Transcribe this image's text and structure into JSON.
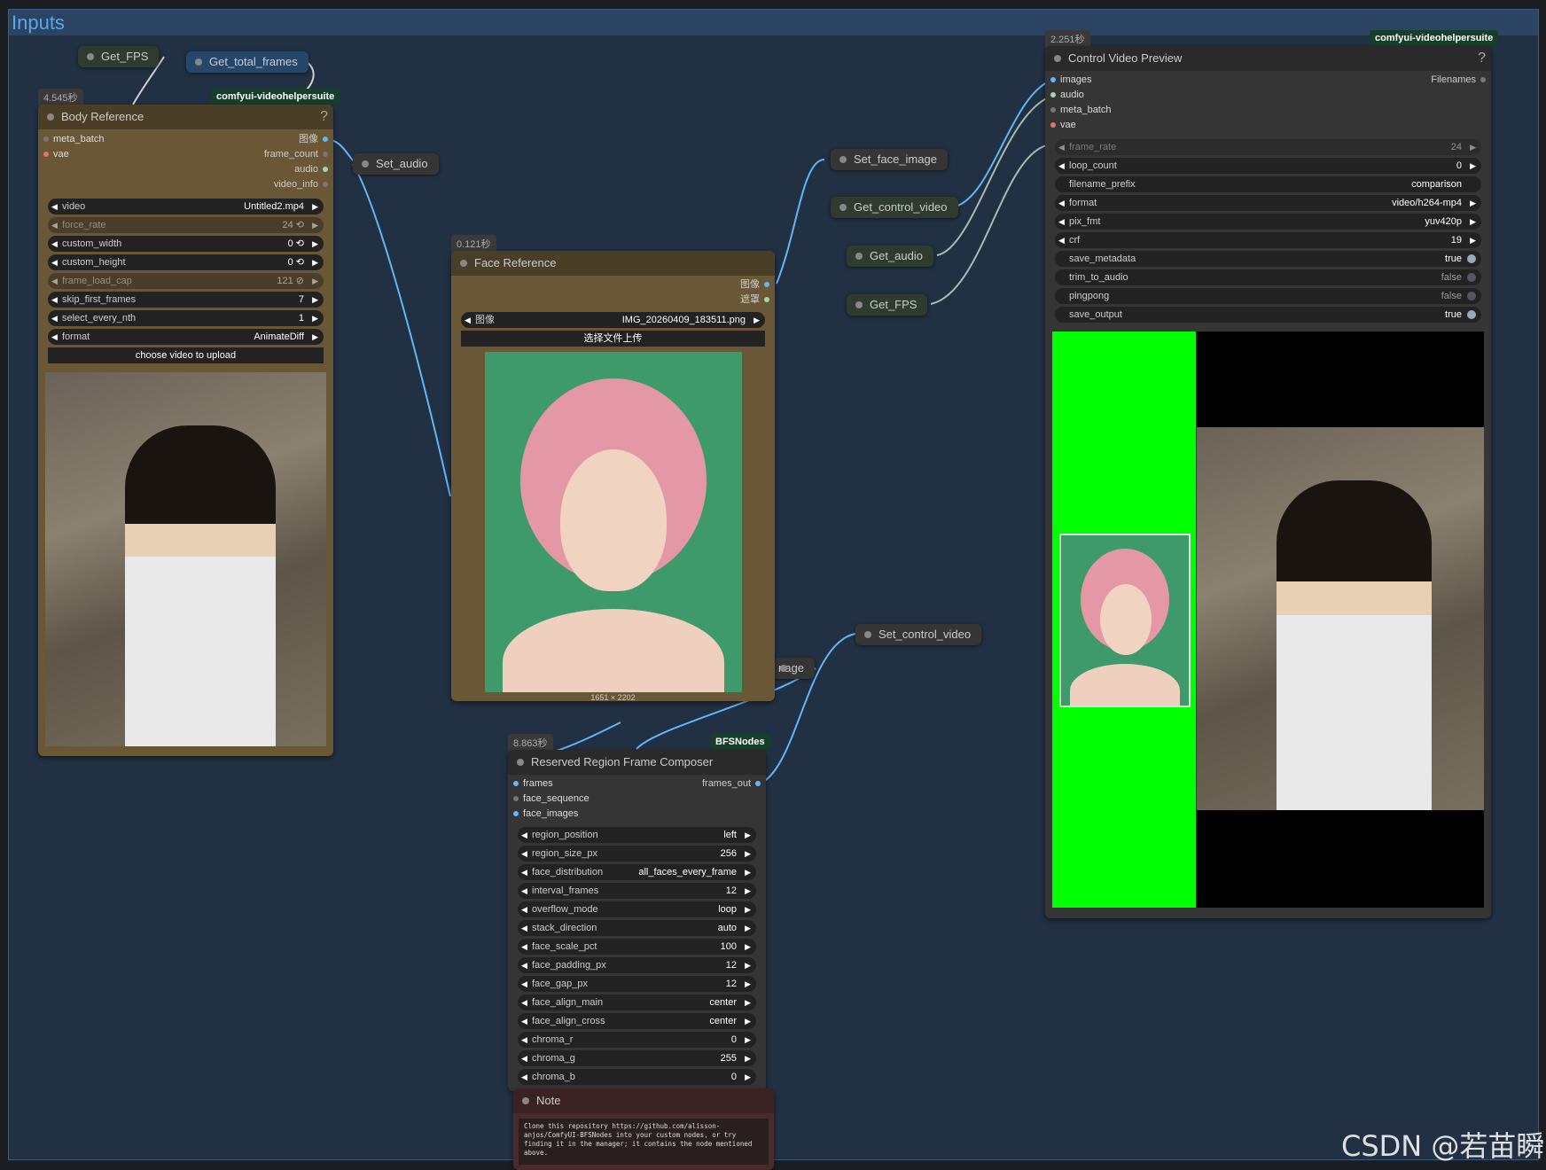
{
  "group": {
    "title": "Inputs"
  },
  "pills": {
    "get_fps_top": "Get_FPS",
    "get_total_frames": "Get_total_frames",
    "set_audio": "Set_audio",
    "set_face_image": "Set_face_image",
    "get_control_video": "Get_control_video",
    "get_audio": "Get_audio",
    "get_fps_right": "Get_FPS",
    "set_control_video": "Set_control_video",
    "image_partial": "nage"
  },
  "body_ref": {
    "time": "4.545秒",
    "tag": "comfyui-videohelpersuite",
    "title": "Body Reference",
    "help": "?",
    "inputs": [
      "meta_batch",
      "vae"
    ],
    "outputs": [
      "图像",
      "frame_count",
      "audio",
      "video_info"
    ],
    "widgets": [
      {
        "label": "video",
        "value": "Untitled2.mp4"
      },
      {
        "label": "force_rate",
        "value": "24 ⟲"
      },
      {
        "label": "custom_width",
        "value": "0 ⟲"
      },
      {
        "label": "custom_height",
        "value": "0 ⟲"
      },
      {
        "label": "frame_load_cap",
        "value": "121 ⊘"
      },
      {
        "label": "skip_first_frames",
        "value": "7"
      },
      {
        "label": "select_every_nth",
        "value": "1"
      },
      {
        "label": "format",
        "value": "AnimateDiff"
      }
    ],
    "upload_button": "choose video to upload"
  },
  "face_ref": {
    "time": "0.121秒",
    "title": "Face Reference",
    "outputs": [
      "图像",
      "遮罩"
    ],
    "widget_label": "图像",
    "widget_value": "IMG_20260409_183511.png",
    "upload_button": "选择文件上传",
    "dims": "1651 × 2202"
  },
  "composer": {
    "time": "8.863秒",
    "tag": "BFSNodes",
    "title": "Reserved Region Frame Composer",
    "inputs": [
      "frames",
      "face_sequence",
      "face_images"
    ],
    "output": "frames_out",
    "widgets": [
      {
        "label": "region_position",
        "value": "left"
      },
      {
        "label": "region_size_px",
        "value": "256"
      },
      {
        "label": "face_distribution",
        "value": "all_faces_every_frame"
      },
      {
        "label": "interval_frames",
        "value": "12"
      },
      {
        "label": "overflow_mode",
        "value": "loop"
      },
      {
        "label": "stack_direction",
        "value": "auto"
      },
      {
        "label": "face_scale_pct",
        "value": "100"
      },
      {
        "label": "face_padding_px",
        "value": "12"
      },
      {
        "label": "face_gap_px",
        "value": "12"
      },
      {
        "label": "face_align_main",
        "value": "center"
      },
      {
        "label": "face_align_cross",
        "value": "center"
      },
      {
        "label": "chroma_r",
        "value": "0"
      },
      {
        "label": "chroma_g",
        "value": "255"
      },
      {
        "label": "chroma_b",
        "value": "0"
      }
    ]
  },
  "note": {
    "title": "Note",
    "text": "Clone this repository https://github.com/alisson-anjos/ComfyUI-BFSNodes into your custom nodes, or try finding it in the manager; it contains the node mentioned above."
  },
  "preview": {
    "time": "2.251秒",
    "tag": "comfyui-videohelpersuite",
    "title": "Control Video Preview",
    "help": "?",
    "inputs": [
      "images",
      "audio",
      "meta_batch",
      "vae"
    ],
    "output": "Filenames",
    "widgets": [
      {
        "label": "frame_rate",
        "value": "24"
      },
      {
        "label": "loop_count",
        "value": "0"
      },
      {
        "label": "filename_prefix",
        "value": "comparison"
      },
      {
        "label": "format",
        "value": "video/h264-mp4"
      },
      {
        "label": "pix_fmt",
        "value": "yuv420p"
      },
      {
        "label": "crf",
        "value": "19"
      }
    ],
    "toggles": [
      {
        "label": "save_metadata",
        "value": "true"
      },
      {
        "label": "trim_to_audio",
        "value": "false"
      },
      {
        "label": "pingpong",
        "value": "false"
      },
      {
        "label": "save_output",
        "value": "true"
      }
    ]
  },
  "watermark": "CSDN @若苗瞬",
  "colors": {
    "chroma_green": "#00ff00",
    "node_brown": "#6a5735",
    "wire_blue": "#64b5f6",
    "wire_gray": "#a8bca8"
  }
}
